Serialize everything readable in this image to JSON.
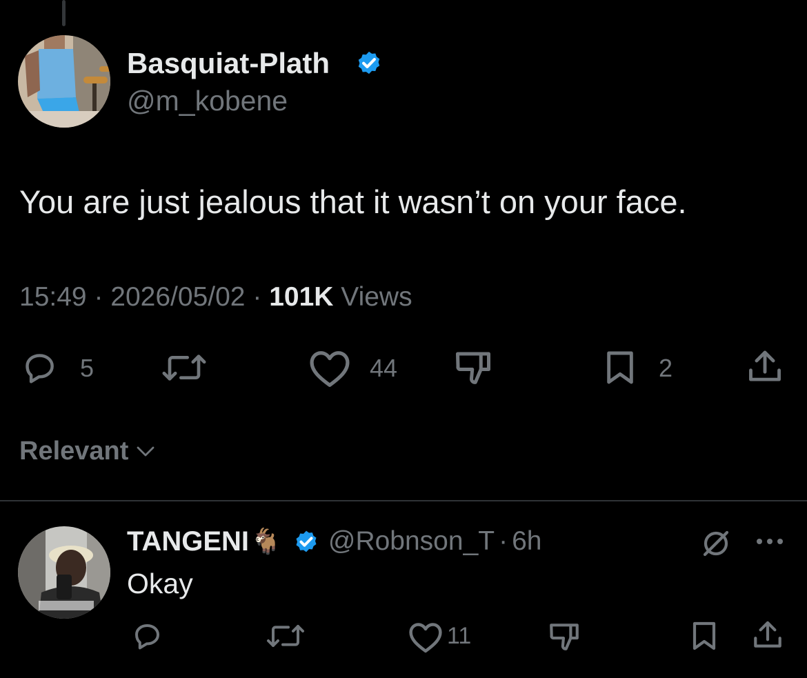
{
  "main_tweet": {
    "display_name": "Basquiat-Plath",
    "handle": "@m_kobene",
    "text": "You are just jealous that it wasn’t on your face.",
    "time": "15:49",
    "date": "2026/05/02",
    "separator": "·",
    "views_count": "101K",
    "views_label": "Views",
    "reply_count": "5",
    "like_count": "44",
    "bookmark_count": "2"
  },
  "sort": {
    "label": "Relevant"
  },
  "reply": {
    "display_name": "TANGENI",
    "emoji": "🐐",
    "handle": "@Robnson_T",
    "separator": "·",
    "age": "6h",
    "text": "Okay",
    "like_count": "11"
  },
  "colors": {
    "verified": "#1d9bf0",
    "muted": "#71767b",
    "background": "#000000",
    "text": "#e7e9ea"
  }
}
